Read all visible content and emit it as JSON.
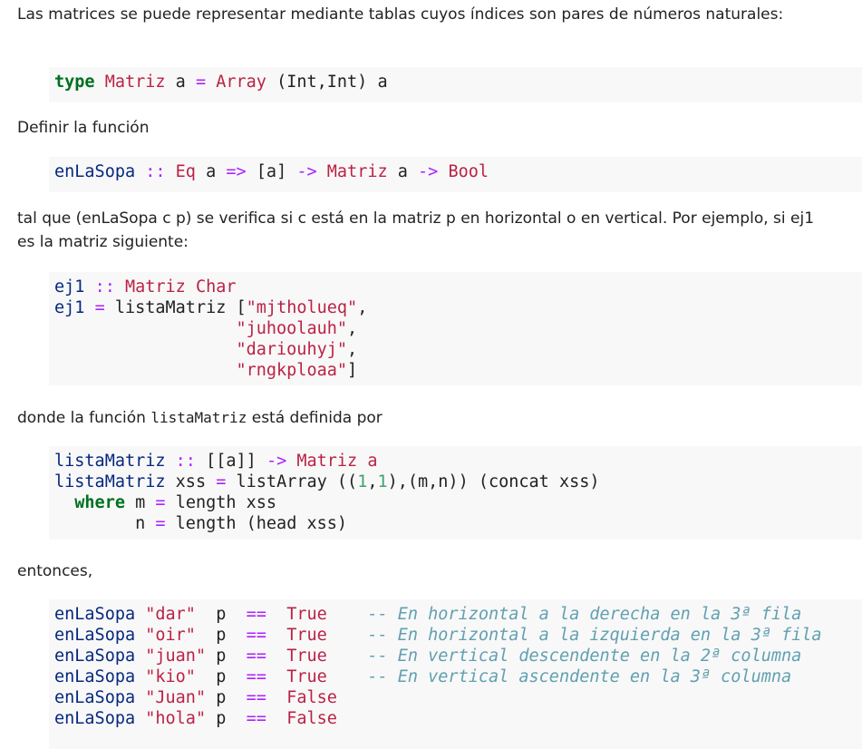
{
  "intro": "Las matrices se puede representar mediante tablas cuyos índices son pares de números naturales:",
  "code_type": {
    "kw_type": "type",
    "name": "Matriz",
    "var": "a",
    "eq": "=",
    "arr": "Array",
    "args": "(Int,Int)",
    "var2": "a"
  },
  "define": "Definir la función",
  "code_sig": {
    "fname": "enLaSopa",
    "sep": "::",
    "cls": "Eq",
    "var": "a",
    "darrow": "=>",
    "list": "[a]",
    "arrow1": "->",
    "mat": "Matriz",
    "var2": "a",
    "arrow2": "->",
    "ret": "Bool"
  },
  "desc": "tal que (enLaSopa c p) se verifica si c está en la matriz p en horizontal o en vertical. Por ejemplo, si ej1 es la matriz siguiente:",
  "code_ej1": {
    "l1_name": "ej1",
    "l1_sep": "::",
    "l1_type": "Matriz Char",
    "l2_name": "ej1",
    "l2_eq": "=",
    "l2_fn": "listaMatriz",
    "l2_open": "[",
    "rows": [
      "\"mjtholueq\"",
      "\"juhoolauh\"",
      "\"dariouhyj\"",
      "\"rngkploaa\""
    ],
    "close": "]"
  },
  "where_prefix": "donde la función",
  "where_code": "listaMatriz",
  "where_suffix": "está definida por",
  "code_lista": {
    "l1_name": "listaMatriz",
    "l1_sep": "::",
    "l1_arg": "[[a]]",
    "l1_arrow": "->",
    "l1_type": "Matriz a",
    "l2_name": "listaMatriz",
    "l2_arg": "xss",
    "l2_eq": "=",
    "l2_fn": "listArray",
    "l2_open": "((",
    "n1": "1",
    "comma1": ",",
    "n2": "1",
    "l2_mid": "),(m,n))",
    "l2_tail": "(concat xss)",
    "l3_kw": "where",
    "l3_var": "m",
    "l3_eq": "=",
    "l3_rest": "length xss",
    "l4_var": "n",
    "l4_eq": "=",
    "l4_rest": "length (head xss)"
  },
  "then": "entonces,",
  "examples": [
    {
      "fn": "enLaSopa",
      "arg": "\"dar\" ",
      "p": "p",
      "eq": "==",
      "res": "True ",
      "comment": "-- En horizontal a la derecha en la 3ª fila"
    },
    {
      "fn": "enLaSopa",
      "arg": "\"oir\" ",
      "p": "p",
      "eq": "==",
      "res": "True ",
      "comment": "-- En horizontal a la izquierda en la 3ª fila"
    },
    {
      "fn": "enLaSopa",
      "arg": "\"juan\"",
      "p": "p",
      "eq": "==",
      "res": "True ",
      "comment": "-- En vertical descendente en la 2ª columna"
    },
    {
      "fn": "enLaSopa",
      "arg": "\"kio\" ",
      "p": "p",
      "eq": "==",
      "res": "True ",
      "comment": "-- En vertical ascendente en la 3ª columna"
    },
    {
      "fn": "enLaSopa",
      "arg": "\"Juan\"",
      "p": "p",
      "eq": "==",
      "res": "False",
      "comment": ""
    },
    {
      "fn": "enLaSopa",
      "arg": "\"hola\"",
      "p": "p",
      "eq": "==",
      "res": "False",
      "comment": ""
    }
  ],
  "colors": {
    "keyword": "#007020",
    "function": "#06287e",
    "string": "#bb2244",
    "comment": "#60a0b0",
    "code_bg": "#f8f8f8"
  }
}
